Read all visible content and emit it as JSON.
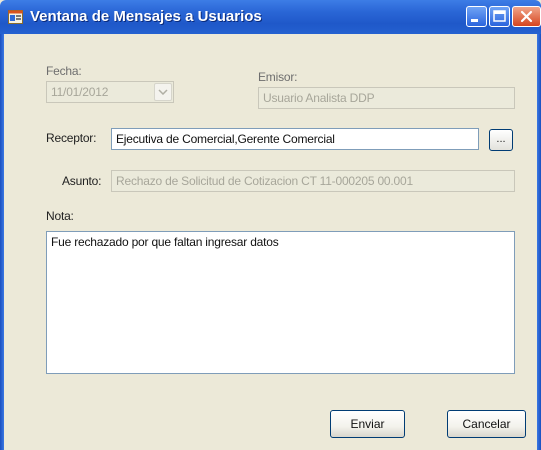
{
  "window": {
    "title": "Ventana de Mensajes a Usuarios",
    "accent_color": "#2a66d6",
    "icons": {
      "app": "app-window-icon",
      "minimize": "minimize-icon",
      "maximize": "maximize-icon",
      "close": "close-icon"
    }
  },
  "form": {
    "fecha_label": "Fecha:",
    "fecha_value": "11/01/2012",
    "emisor_label": "Emisor:",
    "emisor_value": "Usuario Analista DDP",
    "receptor_label": "Receptor:",
    "receptor_value": "Ejecutiva de Comercial,Gerente Comercial",
    "browse_label": "...",
    "asunto_label": "Asunto:",
    "asunto_value": "Rechazo de Solicitud de Cotizacion CT 11-000205 00.001",
    "nota_label": "Nota:",
    "nota_value": "Fue rechazado por que faltan ingresar datos"
  },
  "buttons": {
    "enviar": "Enviar",
    "cancelar": "Cancelar"
  }
}
